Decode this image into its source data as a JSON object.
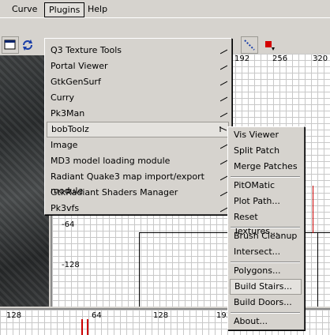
{
  "menubar": {
    "items": [
      "Curve",
      "Plugins",
      "Help"
    ]
  },
  "grid": {
    "top_labels": [
      "192",
      "256",
      "320"
    ],
    "left_labels": [
      "-64",
      "-128"
    ],
    "bottom_labels": [
      "128",
      "64",
      "128",
      "192"
    ]
  },
  "plugins_menu": {
    "items": [
      "Q3 Texture Tools",
      "Portal Viewer",
      "GtkGenSurf",
      "Curry",
      "Pk3Man",
      "bobToolz",
      "Image",
      "MD3 model loading module",
      "Radiant Quake3 map import/export module",
      "GtkRadiant Shaders Manager",
      "Pk3vfs"
    ],
    "highlighted": "bobToolz"
  },
  "bobtoolz_menu": {
    "groups": [
      [
        "Vis Viewer",
        "Split Patch",
        "Merge Patches"
      ],
      [
        "PitOMatic",
        "Plot Path...",
        "Reset Textures..."
      ],
      [
        "Brush Cleanup",
        "Intersect..."
      ],
      [
        "Polygons...",
        "Build Stairs...",
        "Build Doors..."
      ],
      [
        "About..."
      ]
    ],
    "highlighted": "Build Stairs..."
  }
}
